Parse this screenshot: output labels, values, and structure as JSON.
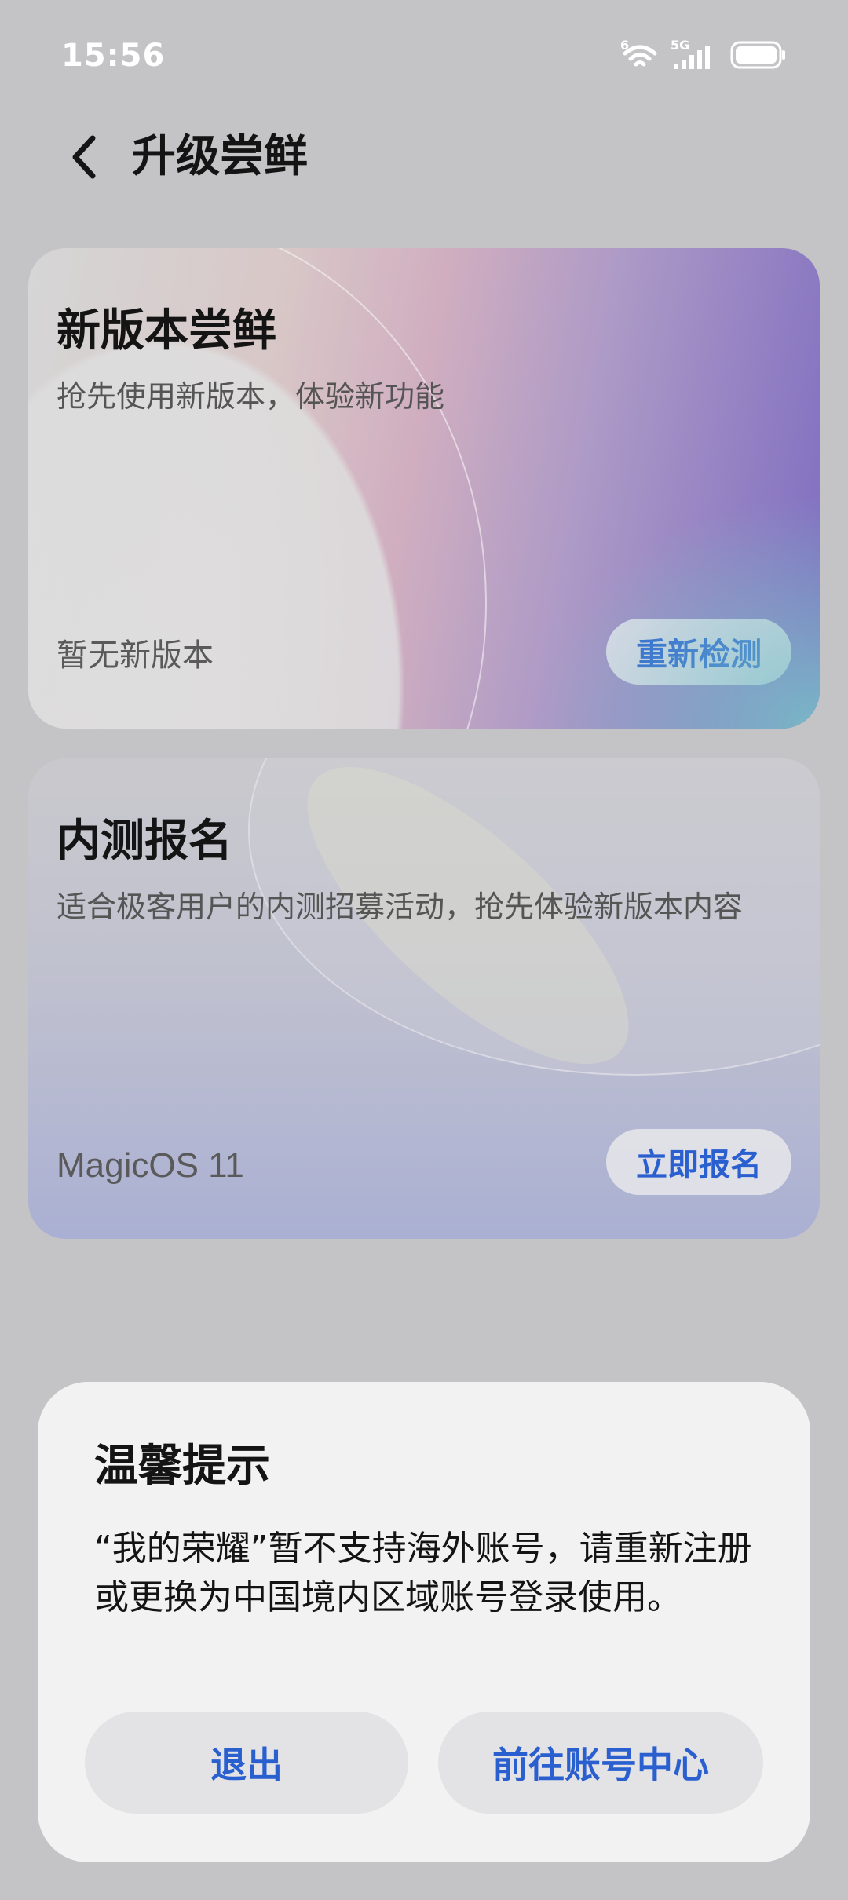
{
  "status_bar": {
    "time": "15:56",
    "wifi_badge": "6",
    "network": "5G",
    "icons": [
      "wifi-icon",
      "signal-icon",
      "battery-icon"
    ]
  },
  "header": {
    "title": "升级尝鲜",
    "back_icon": "chevron-left-icon"
  },
  "cards": [
    {
      "title": "新版本尝鲜",
      "description": "抢先使用新版本，体验新功能",
      "status": "暂无新版本",
      "button": "重新检测"
    },
    {
      "title": "内测报名",
      "description": "适合极客用户的内测招募活动，抢先体验新版本内容",
      "status": "MagicOS 11",
      "button": "立即报名"
    }
  ],
  "dialog": {
    "title": "温馨提示",
    "message": "“我的荣耀”暂不支持海外账号，请重新注册或更换为中国境内区域账号登录使用。",
    "buttons": {
      "exit": "退出",
      "account_center": "前往账号中心"
    }
  },
  "colors": {
    "accent": "#2a5fd0",
    "background": "#c4c4c6",
    "dialog": "#f2f2f2"
  }
}
